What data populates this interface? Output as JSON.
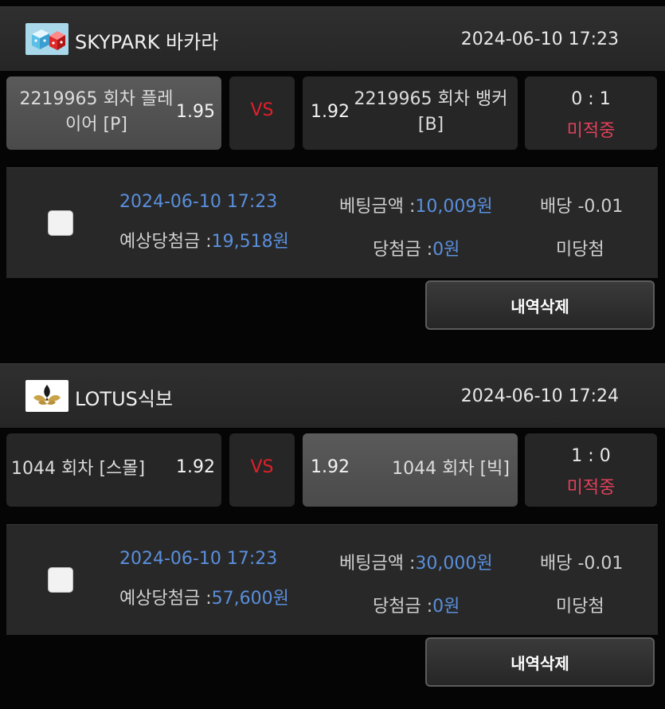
{
  "games": [
    {
      "name": "SKYPARK 바카라",
      "time": "2024-06-10 17:23",
      "logo_icon": "dice-icon",
      "left_team": "2219965 회차 플레이어 [P]",
      "left_team_line1": "2219965 회차 플레",
      "left_team_line2": "이어 [P]",
      "left_odds": "1.95",
      "vs": "VS",
      "right_odds": "1.92",
      "right_team_line1": "2219965 회차 뱅커",
      "right_team_line2": "[B]",
      "score": "0 : 1",
      "status": "미적중",
      "selected": "left",
      "bet": {
        "time": "2024-06-10 17:23",
        "expected_label": "예상당첨금 :",
        "expected_value": "19,518원",
        "amount_label": "베팅금액 :",
        "amount_value": "10,009원",
        "win_label": "당첨금 :",
        "win_value": "0원",
        "dividend": "배당 -0.01",
        "result": "미당첨"
      },
      "delete_label": "내역삭제"
    },
    {
      "name": "LOTUS식보",
      "time": "2024-06-10 17:24",
      "logo_icon": "lotus-icon",
      "left_team_line1": "1044 회차 [스몰]",
      "left_odds": "1.92",
      "vs": "VS",
      "right_odds": "1.92",
      "right_team_line1": "1044 회차 [빅]",
      "score": "1 : 0",
      "status": "미적중",
      "selected": "right",
      "bet": {
        "time": "2024-06-10 17:23",
        "expected_label": "예상당첨금 :",
        "expected_value": "57,600원",
        "amount_label": "베팅금액 :",
        "amount_value": "30,000원",
        "win_label": "당첨금 :",
        "win_value": "0원",
        "dividend": "배당 -0.01",
        "result": "미당첨"
      },
      "delete_label": "내역삭제"
    }
  ],
  "colors": {
    "accent_blue": "#5a8fdc",
    "vs_red": "#e0202a",
    "status_red": "#e0405a"
  }
}
